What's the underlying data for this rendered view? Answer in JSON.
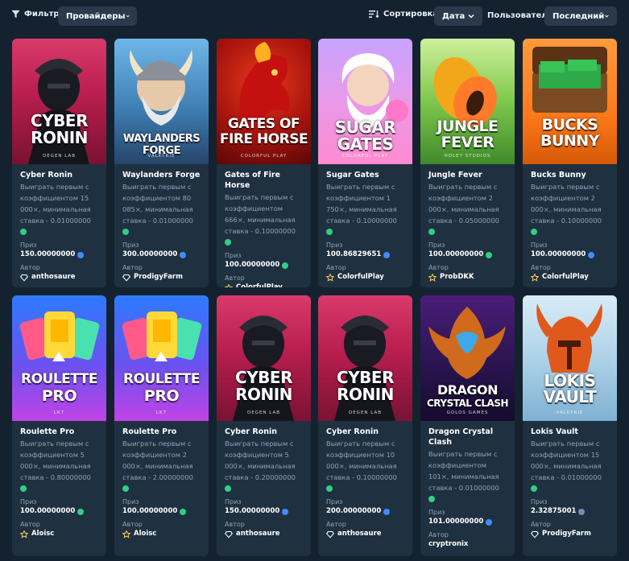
{
  "filter": {
    "label": "Фильтр",
    "providers_value": "Провайдеры"
  },
  "sort": {
    "label": "Сортировка",
    "value": "Дата"
  },
  "user": {
    "label": "Пользователь",
    "value": "Последний"
  },
  "colors": {
    "bg": "#142230",
    "card": "#1f3040",
    "dropdown": "#2a3a4b",
    "muted": "#8fa3b8",
    "green_coin": "#2fcf86",
    "blue_coin": "#3e8cff"
  },
  "labels": {
    "prize": "Приз",
    "author": "Автор"
  },
  "cards": [
    {
      "name": "Cyber Ronin",
      "desc": "Выиграть первым с коэффициентом 15 000×, минимальная ставка - 0.01000000",
      "prize": "150.00000000",
      "coin": "blue",
      "author": "anthosaure",
      "author_icon": "gem-icon",
      "art_title_1": "CYBER",
      "art_title_2": "RONIN",
      "art_studio": "DEGEN LAB"
    },
    {
      "name": "Waylanders Forge",
      "desc": "Выиграть первым с коэффициентом 80 085×, минимальная ставка - 0.01000000",
      "prize": "300.00000000",
      "coin": "blue",
      "author": "ProdigyFarm",
      "author_icon": "gem-icon",
      "art_title_1": "WAYLANDERS",
      "art_title_2": "FORGE",
      "art_studio": "VALKYRIE"
    },
    {
      "name": "Gates of Fire Horse",
      "desc": "Выиграть первым с коэффициентом 666×, минимальная ставка - 0.10000000",
      "prize": "100.00000000",
      "coin": "green",
      "author": "ColorfulPlay",
      "author_icon": "star-icon",
      "art_title_1": "GATES OF",
      "art_title_2": "FIRE HORSE",
      "art_studio": "COLORFUL PLAY"
    },
    {
      "name": "Sugar Gates",
      "desc": "Выиграть первым с коэффициентом 1 750×, минимальная ставка - 0.10000000",
      "prize": "100.86829651",
      "coin": "blue",
      "author": "ColorfulPlay",
      "author_icon": "star-icon",
      "art_title_1": "SUGAR",
      "art_title_2": "GATES",
      "art_studio": "COLORFUL PLAY"
    },
    {
      "name": "Jungle Fever",
      "desc": "Выиграть первым с коэффициентом 2 000×, минимальная ставка - 0.05000000",
      "prize": "100.00000000",
      "coin": "green",
      "author": "ProbDKK",
      "author_icon": "star-icon",
      "art_title_1": "JUNGLE",
      "art_title_2": "FEVER",
      "art_studio": "HOLEY STUDIOS"
    },
    {
      "name": "Bucks Bunny",
      "desc": "Выиграть первым с коэффициентом 2 000×, минимальная ставка - 0.10000000",
      "prize": "100.00000000",
      "coin": "blue",
      "author": "ColorfulPlay",
      "author_icon": "star-icon",
      "art_title_1": "BUCKS",
      "art_title_2": "BUNNY",
      "art_studio": ""
    },
    {
      "name": "Roulette Pro",
      "desc": "Выиграть первым с коэффициентом 5 000×, минимальная ставка - 0.80000000",
      "prize": "100.00000000",
      "coin": "green",
      "author": "Aloisc",
      "author_icon": "star-icon",
      "art_title_1": "ROULETTE",
      "art_title_2": "PRO",
      "art_studio": "LK7"
    },
    {
      "name": "Roulette Pro",
      "desc": "Выиграть первым с коэффициентом 2 000×, минимальная ставка - 2.00000000",
      "prize": "100.00000000",
      "coin": "green",
      "author": "Aloisc",
      "author_icon": "star-icon",
      "art_title_1": "ROULETTE",
      "art_title_2": "PRO",
      "art_studio": "LK7"
    },
    {
      "name": "Cyber Ronin",
      "desc": "Выиграть первым с коэффициентом 5 000×, минимальная ставка - 0.20000000",
      "prize": "150.00000000",
      "coin": "blue",
      "author": "anthosaure",
      "author_icon": "gem-icon",
      "art_title_1": "CYBER",
      "art_title_2": "RONIN",
      "art_studio": "DEGEN LAB"
    },
    {
      "name": "Cyber Ronin",
      "desc": "Выиграть первым с коэффициентом 10 000×, минимальная ставка - 0.10000000",
      "prize": "200.00000000",
      "coin": "blue",
      "author": "anthosaure",
      "author_icon": "gem-icon",
      "art_title_1": "CYBER",
      "art_title_2": "RONIN",
      "art_studio": "DEGEN LAB"
    },
    {
      "name": "Dragon Crystal Clash",
      "desc": "Выиграть первым с коэффициентом 101×, минимальная ставка - 0.01000000",
      "prize": "101.00000000",
      "coin": "blue",
      "author": "cryptronix",
      "author_icon": "",
      "art_title_1": "DRAGON",
      "art_title_2": "CRYSTAL CLASH",
      "art_studio": "GOLOS GAMES"
    },
    {
      "name": "Lokis Vault",
      "desc": "Выиграть первым с коэффициентом 15 000×, минимальная ставка - 0.01000000",
      "prize": "2.32875001",
      "coin": "ltc",
      "author": "ProdigyFarm",
      "author_icon": "gem-icon",
      "art_title_1": "LOKIS",
      "art_title_2": "VAULT",
      "art_studio": "VALKYRIE"
    }
  ]
}
